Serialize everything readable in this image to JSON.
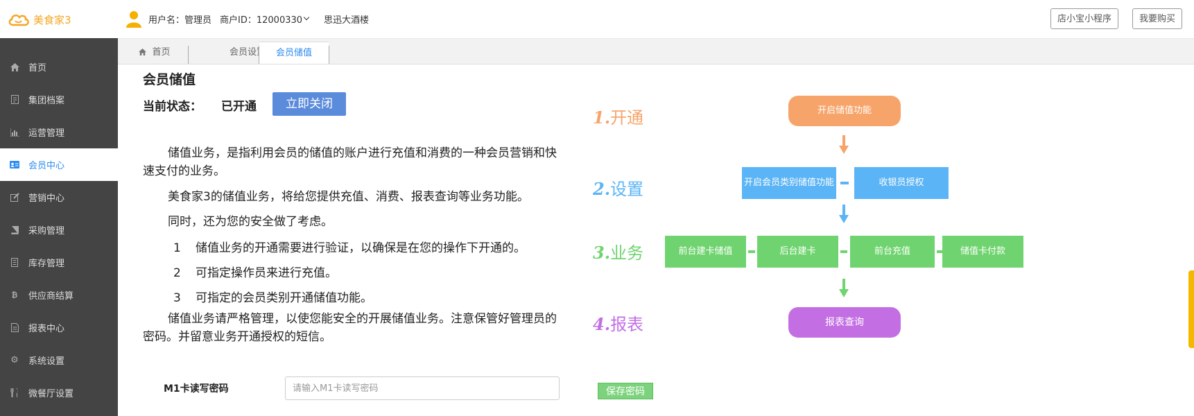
{
  "header": {
    "logo_text": "美食家3",
    "username_label": "用户名：管理员",
    "merchant_label": "商户ID：12000330",
    "store_name": "思迅大酒楼",
    "btn_miniapp": "店小宝小程序",
    "btn_buy": "我要购买"
  },
  "sidebar": {
    "items": [
      {
        "label": "首页",
        "icon": "home-icon"
      },
      {
        "label": "集团档案",
        "icon": "file-icon"
      },
      {
        "label": "运营管理",
        "icon": "bar-chart-icon"
      },
      {
        "label": "会员中心",
        "icon": "member-card-icon"
      },
      {
        "label": "营销中心",
        "icon": "edit-icon"
      },
      {
        "label": "采购管理",
        "icon": "book-icon"
      },
      {
        "label": "库存管理",
        "icon": "list-icon"
      },
      {
        "label": "供应商结算",
        "icon": "bitcoin-icon"
      },
      {
        "label": "报表中心",
        "icon": "report-icon"
      },
      {
        "label": "系统设置",
        "icon": "gear-icon"
      },
      {
        "label": "微餐厅设置",
        "icon": "cutlery-icon"
      }
    ],
    "active_index": 3
  },
  "tabs": [
    {
      "label": "首页",
      "icon": "home-icon"
    },
    {
      "label": "会员设置"
    },
    {
      "label": "会员储值"
    }
  ],
  "main": {
    "title": "会员储值",
    "status_label": "当前状态：",
    "status_value": "已开通",
    "close_button": "立即关闭",
    "para1": "储值业务，是指利用会员的储值的账户进行充值和消费的一种会员营销和快速支付的业务。",
    "para2": "美食家3的储值业务，将给您提供充值、消费、报表查询等业务功能。",
    "para3": "同时，还为您的安全做了考虑。",
    "items": [
      {
        "num": "1",
        "text": "储值业务的开通需要进行验证，以确保是在您的操作下开通的。"
      },
      {
        "num": "2",
        "text": "可指定操作员来进行充值。"
      },
      {
        "num": "3",
        "text": "可指定的会员类别开通储值功能。"
      }
    ],
    "para4": "储值业务请严格管理，以使您能安全的开展储值业务。注意保管好管理员的密码。并留意业务开通授权的短信。",
    "m1_label": "M1卡读写密码",
    "m1_placeholder": "请输入M1卡读写密码",
    "m1_value": "",
    "save_button": "保存密码"
  },
  "flow": {
    "steps": [
      {
        "num": "1.",
        "label": "开通",
        "color": "#f7a46a"
      },
      {
        "num": "2.",
        "label": "设置",
        "color": "#5bb4f5"
      },
      {
        "num": "3.",
        "label": "业务",
        "color": "#6fd46f"
      },
      {
        "num": "4.",
        "label": "报表",
        "color": "#c36fe3"
      }
    ],
    "enable": "开启储值功能",
    "setting_boxes": [
      "开启会员类别储值功能",
      "收银员授权"
    ],
    "business_boxes": [
      "前台建卡储值",
      "后台建卡",
      "前台充值",
      "储值卡付款"
    ],
    "report": "报表查询"
  },
  "colors": {
    "sidebar_bg": "#444444",
    "active": "#2d8cf0",
    "logo": "#f5a623",
    "orange": "#f7a46a",
    "blue": "#5bb4f5",
    "green": "#6fd46f",
    "purple": "#c36fe3"
  }
}
